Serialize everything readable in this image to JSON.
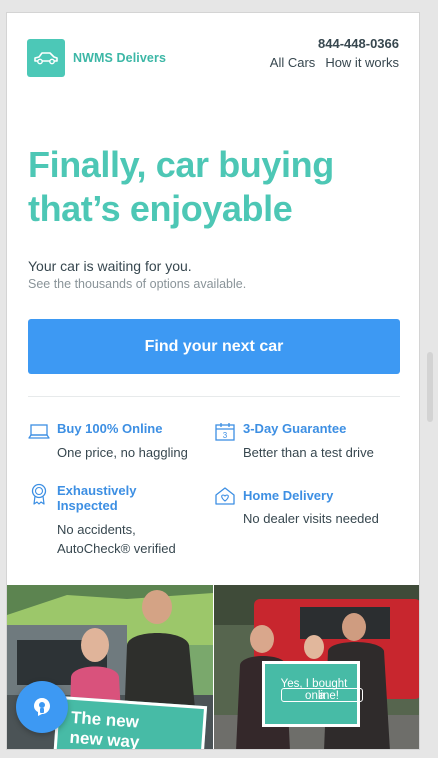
{
  "header": {
    "brand": "NWMS Delivers",
    "phone": "844-448-0366",
    "nav": [
      "All Cars",
      "How it works"
    ]
  },
  "hero": {
    "headline_line1": "Finally, car buying",
    "headline_line2": "that’s enjoyable",
    "subtitle": "Your car is waiting for you.",
    "subtext": "See the thousands of options available.",
    "cta_label": "Find your next car"
  },
  "features": [
    {
      "icon": "laptop-icon",
      "title": "Buy 100% Online",
      "desc": [
        "One price, no haggling"
      ]
    },
    {
      "icon": "calendar-icon",
      "title": "3-Day Guarantee",
      "desc": [
        "Better than a test drive"
      ],
      "calendar_number": "3"
    },
    {
      "icon": "ribbon-badge-icon",
      "title": "Exhaustively Inspected",
      "title_lines": [
        "Exhaustively",
        "Inspected"
      ],
      "desc": [
        "No accidents,",
        "AutoCheck® verified"
      ]
    },
    {
      "icon": "home-delivery-icon",
      "title": "Home Delivery",
      "desc": [
        "No dealer visits needed"
      ]
    }
  ],
  "photos": {
    "left_sign": [
      "The new",
      "new way"
    ],
    "right_sign": [
      "Yes, I bought",
      "a",
      "online!"
    ]
  },
  "colors": {
    "accent_teal": "#4dc7b5",
    "cta_blue": "#3d99f3",
    "feature_blue": "#3d8fe3",
    "text_dark": "#37474f"
  }
}
